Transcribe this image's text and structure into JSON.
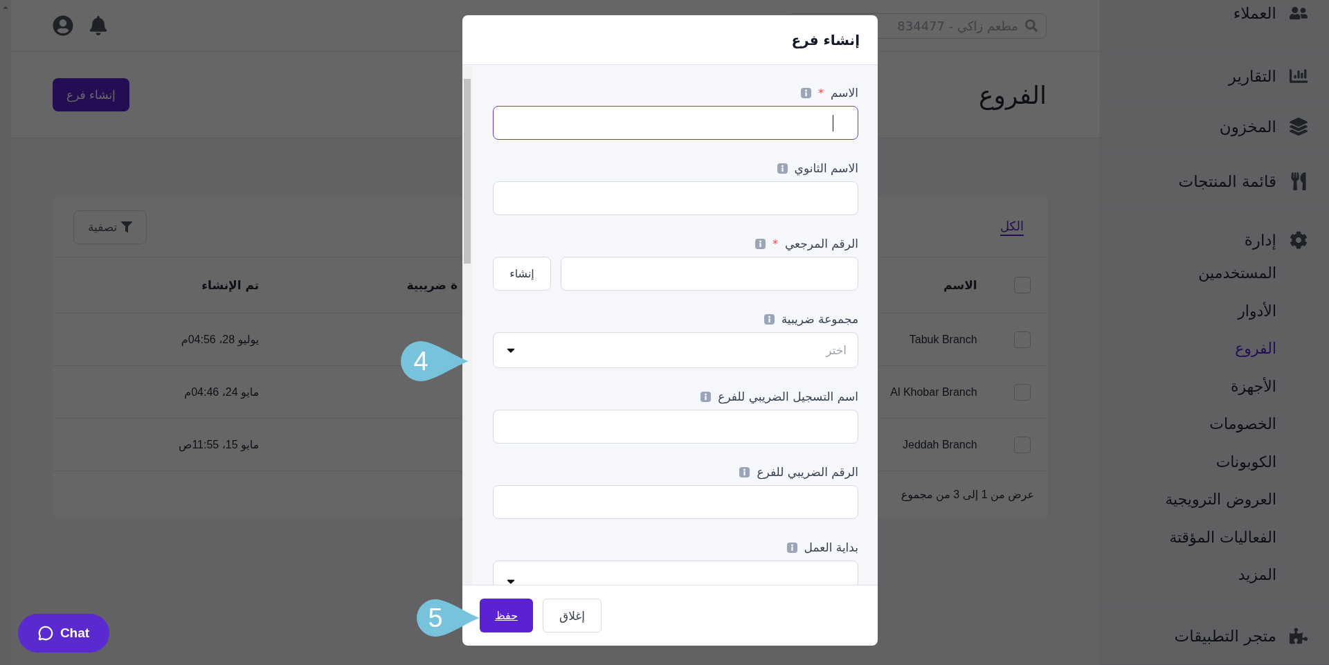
{
  "topbar": {
    "search": {
      "value": "مطعم زاكي - 834477"
    }
  },
  "page": {
    "title": "الفروع",
    "create_button": "إنشاء فرع"
  },
  "branches_card": {
    "tabs": [
      {
        "label": "الكل",
        "selected": true
      }
    ],
    "filter_button": "تصفية",
    "table": {
      "select_all_checked": false,
      "columns": [
        "الاسم",
        "ة ضريبية",
        "تم الإنشاء"
      ],
      "rows": [
        {
          "checked": false,
          "name": "Tabuk Branch",
          "created": "يوليو 28، 04:56م"
        },
        {
          "checked": false,
          "name": "Al Khobar Branch",
          "created": "مايو 24، 04:46م"
        },
        {
          "checked": false,
          "name": "Jeddah Branch",
          "created": "مايو 15، 11:55ص"
        }
      ]
    },
    "pagination": "عرض من 1 إلى 3 من مجموع"
  },
  "sidebar": {
    "items": [
      {
        "label": "العملاء"
      },
      {
        "label": "التقارير"
      },
      {
        "label": "المخزون"
      },
      {
        "label": "قائمة المنتجات"
      },
      {
        "label": "إدارة",
        "children": [
          {
            "label": "المستخدمين",
            "selected": false
          },
          {
            "label": "الأدوار",
            "selected": false
          },
          {
            "label": "الفروع",
            "selected": true
          },
          {
            "label": "الأجهزة",
            "selected": false
          },
          {
            "label": "الخصومات",
            "selected": false
          },
          {
            "label": "الكوبونات",
            "selected": false
          },
          {
            "label": "العروض الترويجية",
            "selected": false
          },
          {
            "label": "الفعاليات المؤقتة",
            "selected": false
          },
          {
            "label": "المزيد",
            "selected": false
          }
        ]
      },
      {
        "label": "متجر التطبيقات"
      }
    ]
  },
  "dialog": {
    "title": "إنشاء فرع",
    "fields": [
      {
        "kind": "text",
        "label": "الاسم",
        "required_mark": "*",
        "focused": true
      },
      {
        "kind": "text",
        "label": "الاسم الثانوي",
        "focused": false
      },
      {
        "kind": "text_with_button",
        "label": "الرقم المرجعي",
        "required_mark": "*",
        "focused": false,
        "button": "إنشاء"
      },
      {
        "kind": "select",
        "label": "مجموعة ضريبية",
        "focused": false,
        "placeholder": "اختر"
      },
      {
        "kind": "text",
        "label": "اسم التسجيل الضريبي للفرع",
        "focused": false
      },
      {
        "kind": "text",
        "label": "الرقم الضريبي للفرع",
        "focused": false
      },
      {
        "kind": "select",
        "label": "بداية العمل",
        "focused": false
      }
    ],
    "save_button": "حفظ",
    "close_button": "إغلاق"
  },
  "callouts": [
    {
      "label": "4"
    },
    {
      "label": "5"
    }
  ],
  "chat_button": "Chat"
}
